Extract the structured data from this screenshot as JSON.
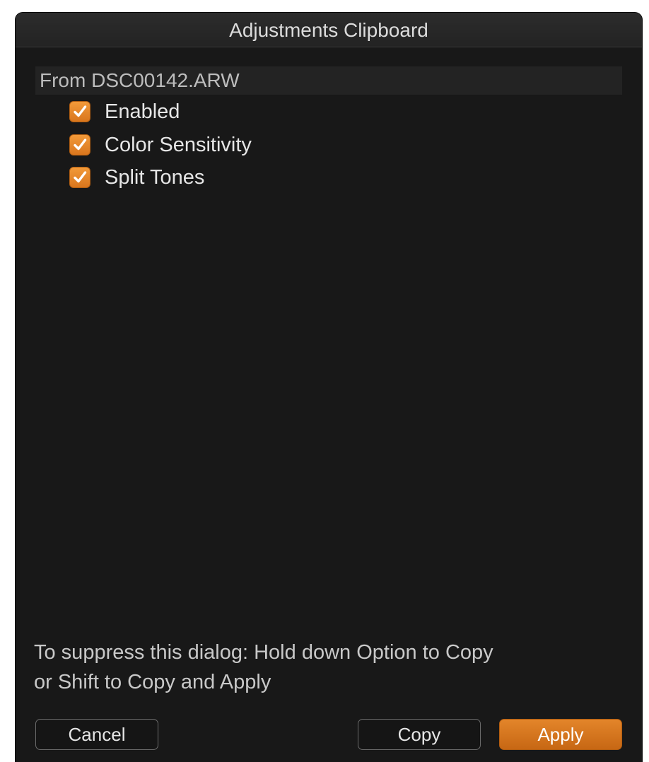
{
  "dialog": {
    "title": "Adjustments Clipboard"
  },
  "source": {
    "label": "From DSC00142.ARW"
  },
  "options": [
    {
      "label": "Enabled",
      "checked": true
    },
    {
      "label": "Color Sensitivity",
      "checked": true
    },
    {
      "label": "Split Tones",
      "checked": true
    }
  ],
  "hint": {
    "line1": "To suppress this dialog: Hold down Option to Copy",
    "line2": "or Shift to Copy and Apply"
  },
  "buttons": {
    "cancel": "Cancel",
    "copy": "Copy",
    "apply": "Apply"
  },
  "colors": {
    "accent": "#e07f22",
    "background": "#181818"
  },
  "icons": {
    "checkbox": "checkmark-icon"
  }
}
